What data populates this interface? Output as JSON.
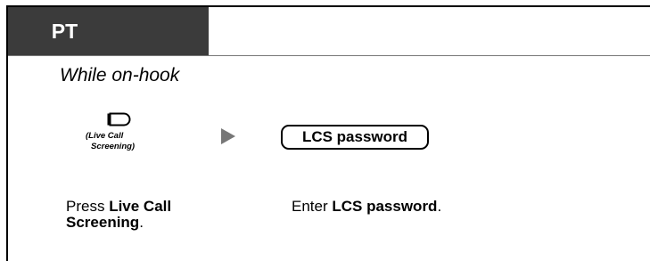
{
  "header": {
    "tab_label": "PT"
  },
  "condition": "While on-hook",
  "steps": [
    {
      "key_icon": "feature-key-icon",
      "key_caption_line1": "(Live Call",
      "key_caption_line2": "Screening)",
      "instruction_prefix": "Press ",
      "instruction_bold_1": "Live Call",
      "instruction_bold_2": "Screening",
      "instruction_suffix": "."
    },
    {
      "arrow_icon": "next-step-arrow-icon",
      "box_label": "LCS password",
      "instruction_prefix": "Enter ",
      "instruction_bold": "LCS password",
      "instruction_suffix": "."
    }
  ]
}
